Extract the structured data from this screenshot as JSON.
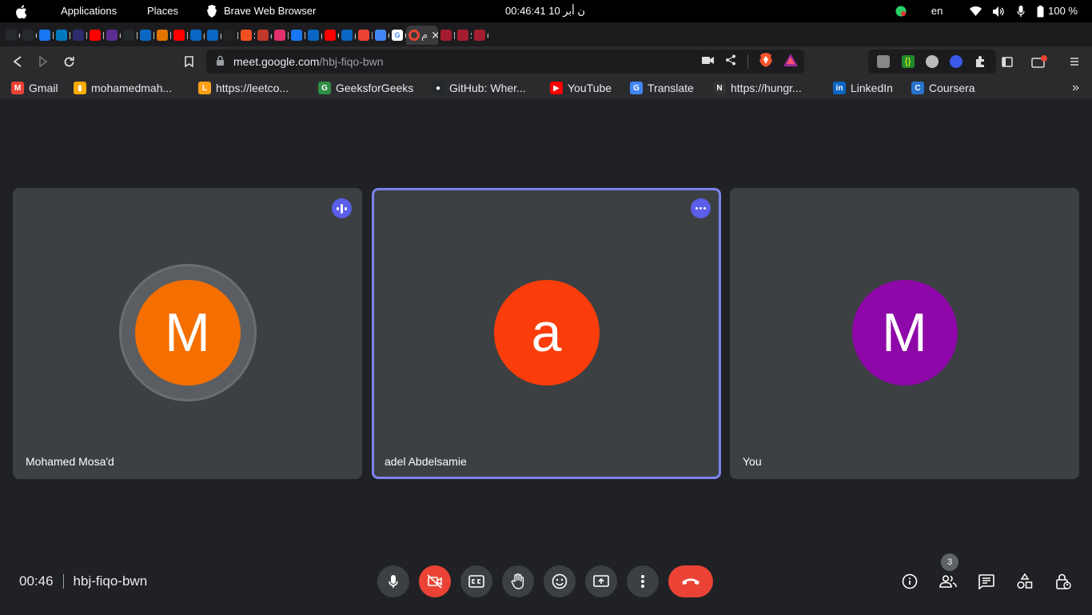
{
  "topbar": {
    "applications": "Applications",
    "places": "Places",
    "browser_name": "Brave Web Browser",
    "clock": "00:46:41  ن أبر 10",
    "lang": "en",
    "battery": "100 %"
  },
  "tabs": {
    "items": [
      {
        "icon": "github-icon",
        "label": "C",
        "color": "#24292e"
      },
      {
        "icon": "github-icon",
        "label": "C",
        "color": "#24292e"
      },
      {
        "icon": "facebook-icon",
        "label": "P",
        "color": "#1877f2"
      },
      {
        "icon": "trello-icon",
        "label": "B",
        "color": "#0079bf"
      },
      {
        "icon": "h-icon",
        "label": "R",
        "color": "#2d2d6b"
      },
      {
        "icon": "youtube-icon",
        "label": "R",
        "color": "#ff0000"
      },
      {
        "icon": "c-icon",
        "label": "C",
        "color": "#5b2d90"
      },
      {
        "icon": "github-icon",
        "label": "M",
        "color": "#24292e"
      },
      {
        "icon": "linkedin-icon",
        "label": "F",
        "color": "#0a66c2"
      },
      {
        "icon": "chart-icon",
        "label": "P",
        "color": "#e37400"
      },
      {
        "icon": "youtube-icon",
        "label": "H",
        "color": "#ff0000"
      },
      {
        "icon": "linkedin-icon",
        "label": "(2",
        "color": "#0a66c2"
      },
      {
        "icon": "linkedin-icon",
        "label": "(1",
        "color": "#0a66c2"
      },
      {
        "icon": "dark-icon",
        "label": "D",
        "color": "#222222"
      },
      {
        "icon": "microsoft-icon",
        "label": "S",
        "color": "#f25022"
      },
      {
        "icon": "dish-icon",
        "label": "e",
        "color": "#c0392b"
      },
      {
        "icon": "instagram-icon",
        "label": "I",
        "color": "#e1306c"
      },
      {
        "icon": "facebook-icon",
        "label": "F",
        "color": "#1877f2"
      },
      {
        "icon": "linkedin-icon",
        "label": "(1",
        "color": "#0a66c2"
      },
      {
        "icon": "youtube-icon",
        "label": "G",
        "color": "#ff0000"
      },
      {
        "icon": "linkedin-icon",
        "label": "(1",
        "color": "#0a66c2"
      },
      {
        "icon": "gmail-icon",
        "label": "Ir",
        "color": "#ea4335"
      },
      {
        "icon": "translate-icon",
        "label": "G",
        "color": "#4285f4"
      },
      {
        "icon": "google-icon",
        "label": "G",
        "color": "#ffffff"
      }
    ],
    "active": {
      "icon": "meet-record-icon",
      "label": "م",
      "color": "#ea4335"
    },
    "after": [
      {
        "icon": "harvard-icon",
        "label": "P",
        "color": "#a51c30"
      },
      {
        "icon": "harvard-icon",
        "label": "S",
        "color": "#a51c30"
      },
      {
        "icon": "harvard-icon",
        "label": "C",
        "color": "#a51c30"
      }
    ]
  },
  "toolbar": {
    "url_host": "meet.google.com",
    "url_path": "/hbj-fiqo-bwn"
  },
  "bookmarks": [
    {
      "label": "Gmail",
      "icon": "gmail-icon",
      "color": "#ea4335",
      "glyph": "M"
    },
    {
      "label": "mohamedmah...",
      "icon": "analytics-icon",
      "color": "#f9ab00",
      "glyph": "▮"
    },
    {
      "label": "https://leetco...",
      "icon": "leetcode-icon",
      "color": "#ffa116",
      "glyph": "L"
    },
    {
      "label": "GeeksforGeeks",
      "icon": "geeksforgeeks-icon",
      "color": "#2f8d46",
      "glyph": "G"
    },
    {
      "label": "GitHub: Wher...",
      "icon": "github-icon",
      "color": "#24292e",
      "glyph": "●"
    },
    {
      "label": "YouTube",
      "icon": "youtube-icon",
      "color": "#ff0000",
      "glyph": "▶"
    },
    {
      "label": "Translate",
      "icon": "translate-icon",
      "color": "#4285f4",
      "glyph": "G"
    },
    {
      "label": "https://hungr...",
      "icon": "notion-icon",
      "color": "#333333",
      "glyph": "N"
    },
    {
      "label": "LinkedIn",
      "icon": "linkedin-icon",
      "color": "#0a66c2",
      "glyph": "in"
    },
    {
      "label": "Coursera",
      "icon": "coursera-icon",
      "color": "#2a73cc",
      "glyph": "C"
    }
  ],
  "meet": {
    "tiles": [
      {
        "name": "Mohamed Mosa'd",
        "initial": "M",
        "color": "#f56e00",
        "badge": "audio-level-icon"
      },
      {
        "name": "adel Abdelsamie",
        "initial": "a",
        "color": "#fa3d0b",
        "badge": "more-options-icon"
      },
      {
        "name": "You",
        "initial": "M",
        "color": "#8e07a8",
        "badge": ""
      }
    ],
    "time": "00:46",
    "meeting_code": "hbj-fiqo-bwn",
    "participant_count": "3"
  }
}
